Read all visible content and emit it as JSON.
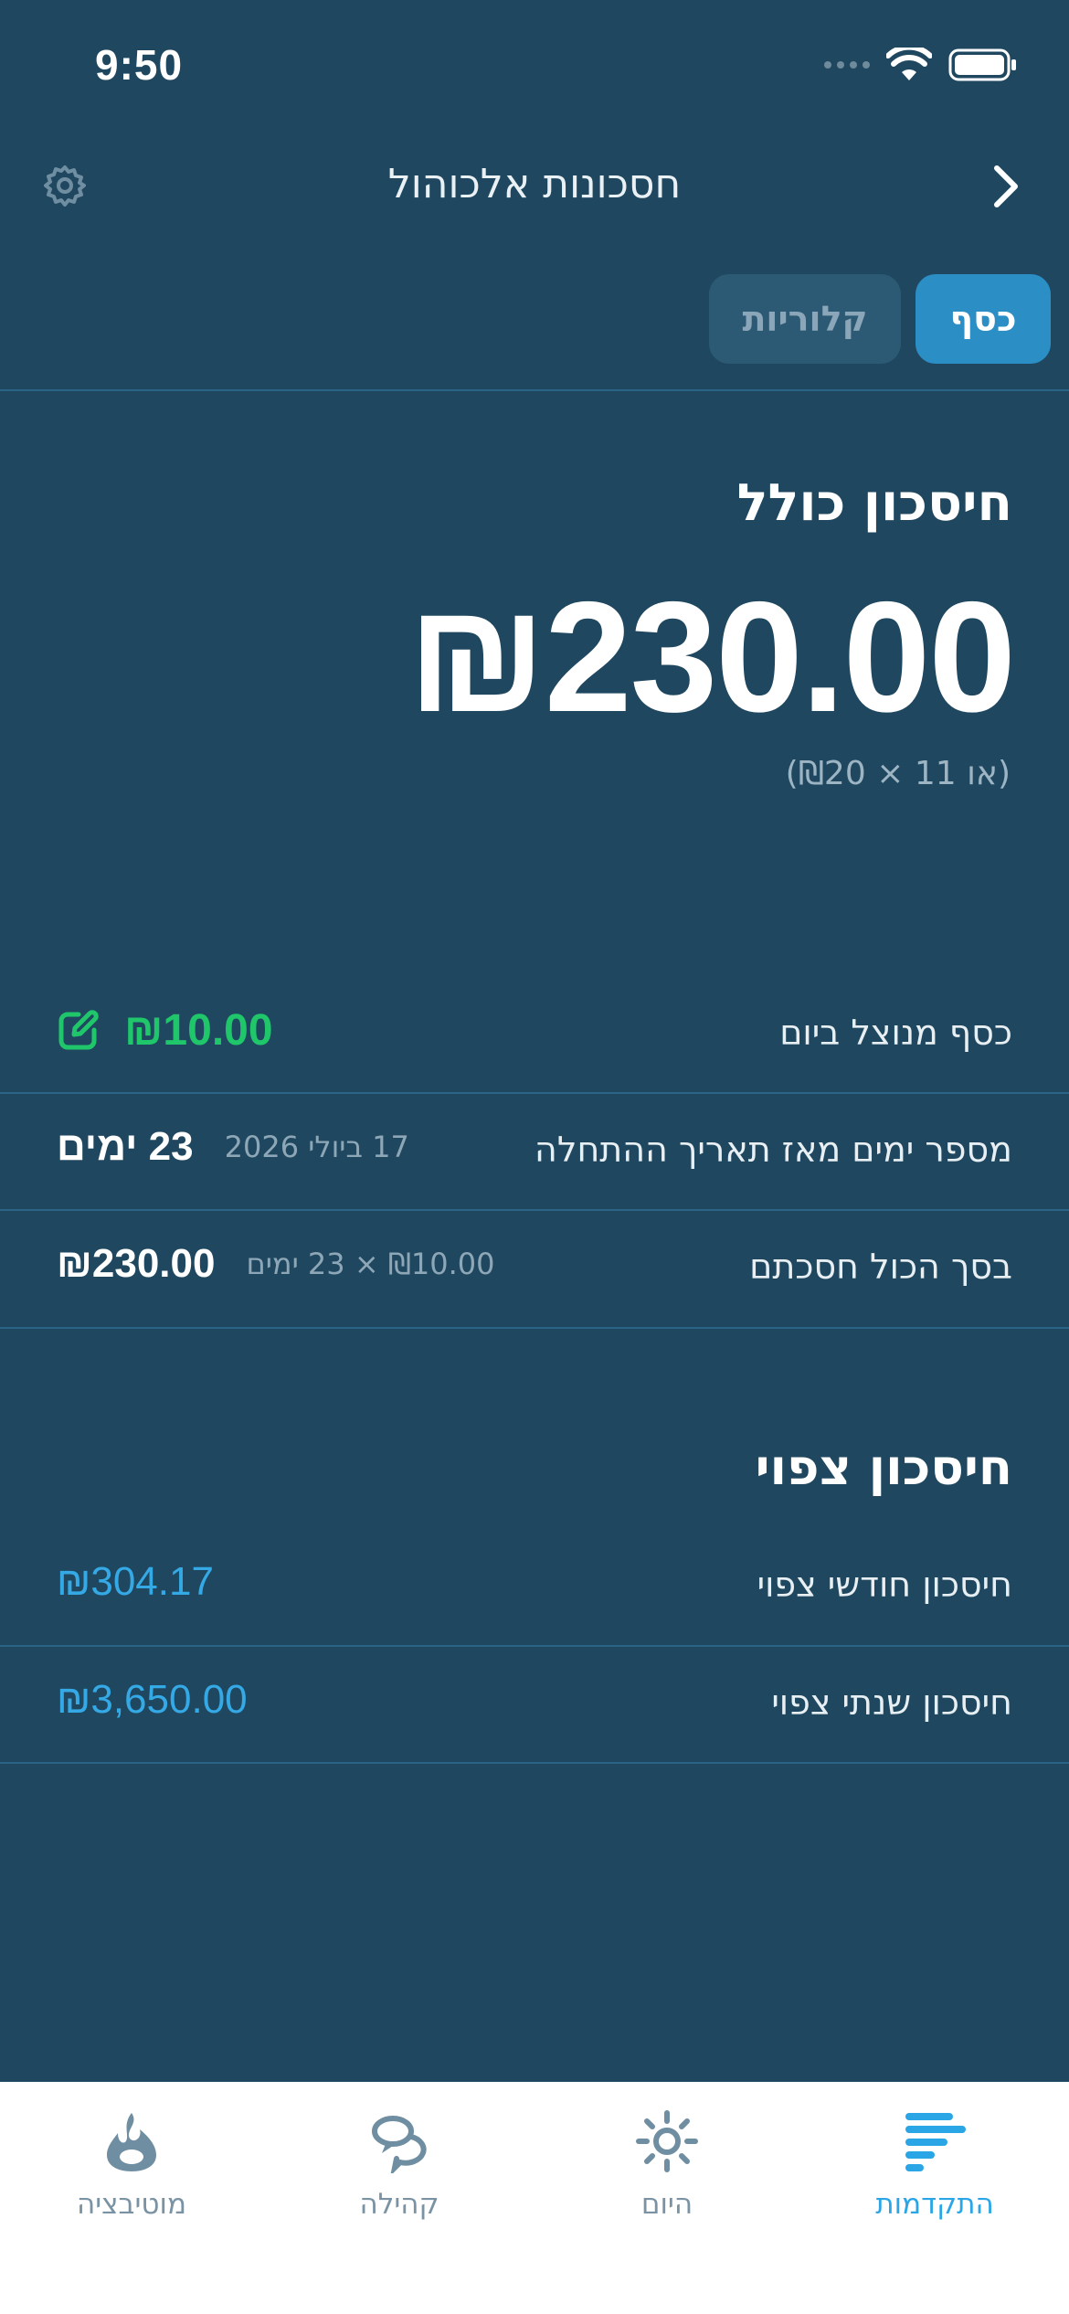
{
  "status_bar": {
    "time": "9:50"
  },
  "nav": {
    "title": "חסכונות אלכוהול"
  },
  "tabs": [
    {
      "label": "כסף",
      "active": true
    },
    {
      "label": "קלוריות",
      "active": false
    }
  ],
  "total": {
    "heading": "חיסכון כולל",
    "amount": "₪230.00",
    "note": "(או 11 × ₪20)"
  },
  "rows": {
    "daily": {
      "label": "כסף מנוצל ביום",
      "value": "₪10.00"
    },
    "days": {
      "label": "מספר ימים מאז תאריך ההתחלה",
      "date": "17 ביולי 2026",
      "value": "23 ימים"
    },
    "saved": {
      "label": "בסך הכול חסכתם",
      "formula": "₪10.00 × 23 ימים",
      "value": "₪230.00"
    }
  },
  "projected": {
    "heading": "חיסכון צפוי",
    "monthly": {
      "label": "חיסכון חודשי צפוי",
      "value": "₪304.17"
    },
    "yearly": {
      "label": "חיסכון שנתי צפוי",
      "value": "₪3,650.00"
    }
  },
  "tabbar": [
    {
      "label": "התקדמות",
      "icon": "progress-bars-icon",
      "active": true
    },
    {
      "label": "היום",
      "icon": "sun-icon",
      "active": false
    },
    {
      "label": "קהילה",
      "icon": "community-icon",
      "active": false
    },
    {
      "label": "מוטיבציה",
      "icon": "flame-icon",
      "active": false
    }
  ],
  "colors": {
    "background": "#1f4860",
    "accent": "#2b8fc6",
    "green": "#1fc76a",
    "blue": "#35a9e6"
  }
}
